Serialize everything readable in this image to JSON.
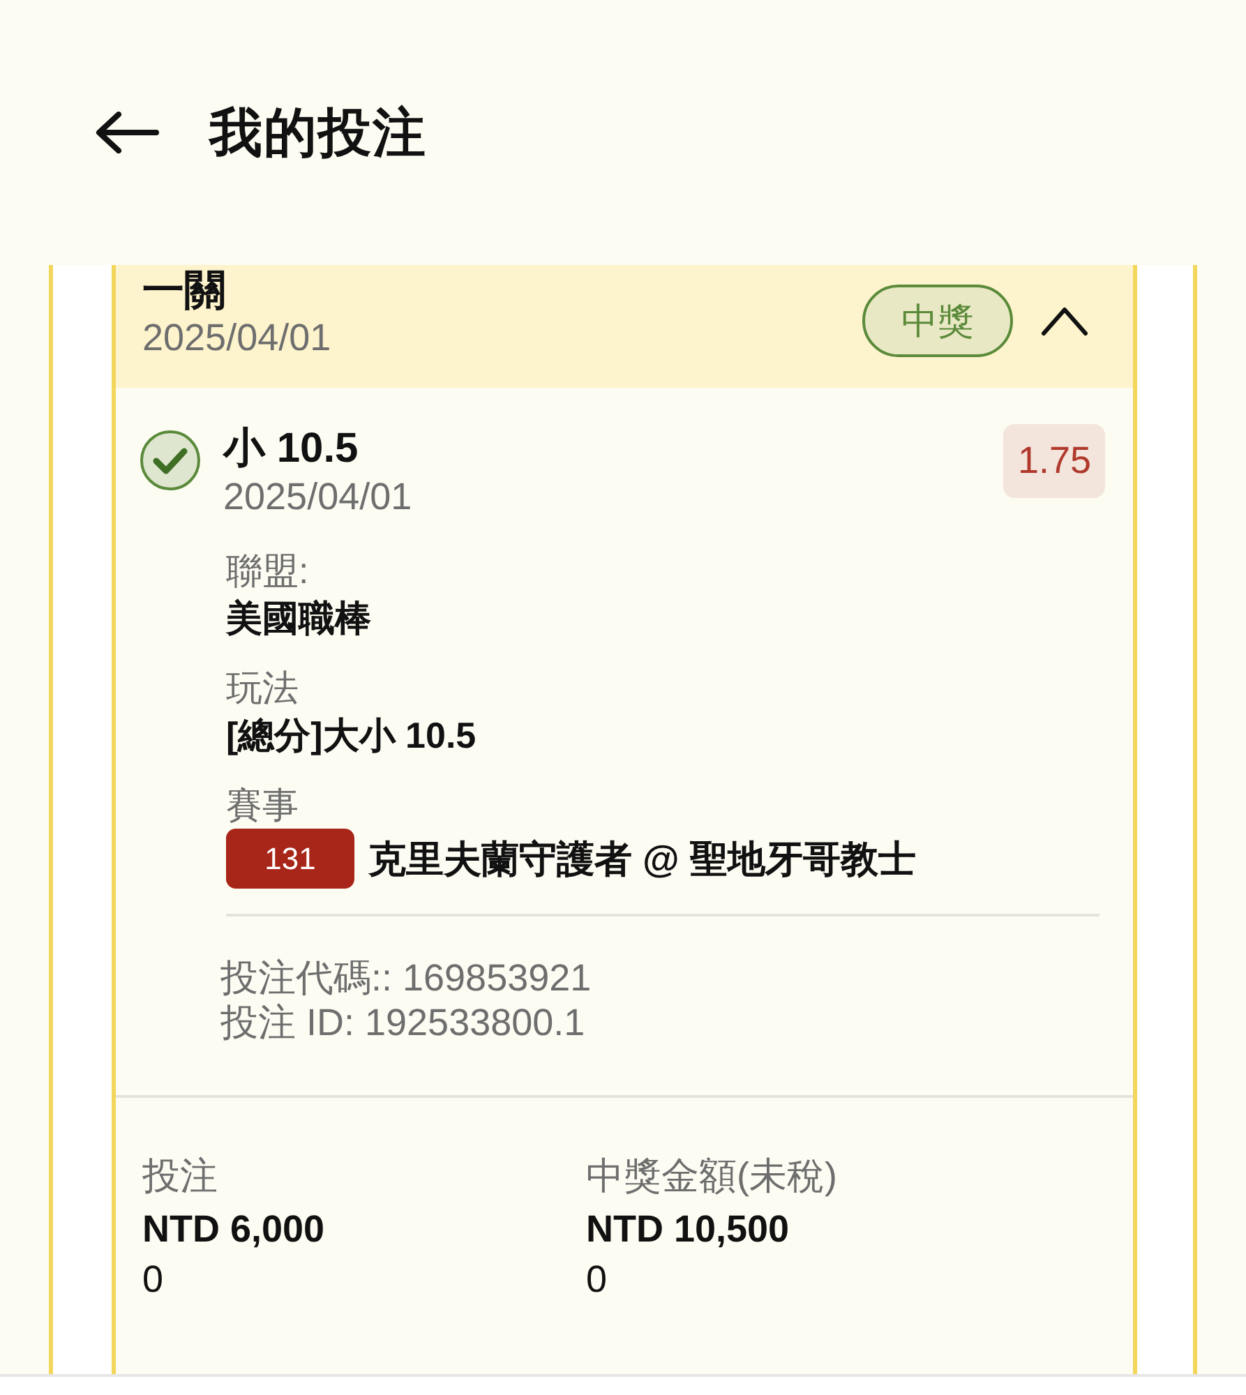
{
  "header": {
    "title": "我的投注"
  },
  "bet": {
    "title": "一關",
    "date": "2025/04/01",
    "badge": {
      "label": "中獎",
      "kind": "won"
    },
    "expanded": true,
    "selections": [
      {
        "won": true,
        "name": "小 10.5",
        "date": "2025/04/01",
        "odds": "1.75",
        "details": [
          {
            "label": "聯盟:",
            "value": "美國職棒"
          },
          {
            "label": "玩法",
            "value": "[總分]大小 10.5"
          },
          {
            "label": "賽事",
            "tag": "131",
            "value": "克里夫蘭守護者 @ 聖地牙哥教士"
          }
        ],
        "codes": [
          "投注代碼:: 169853921",
          "投注 ID: 192533800.1"
        ]
      }
    ],
    "summary": [
      {
        "label": "投注",
        "amount": "NTD 6,000",
        "extra": "0"
      },
      {
        "label": "中獎金額(未稅)",
        "amount": "NTD 10,500",
        "extra": "0"
      }
    ]
  }
}
